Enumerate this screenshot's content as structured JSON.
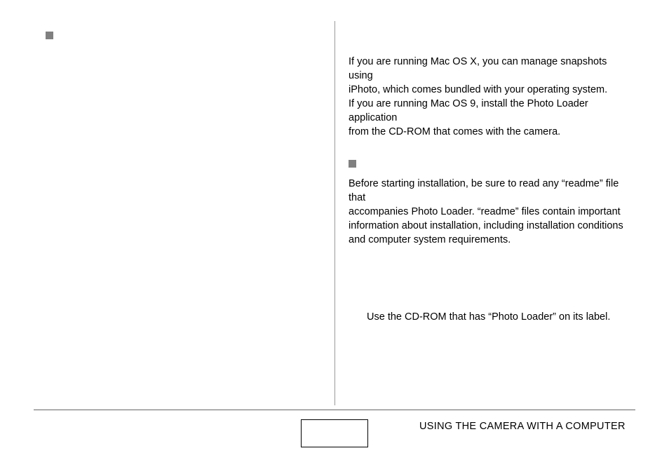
{
  "left": {},
  "right": {
    "para1_line1": "If you are running Mac OS X, you can manage snapshots using",
    "para1_line2": "iPhoto, which comes bundled with your operating system.",
    "para2_line1": "If you are running Mac OS 9, install the Photo Loader application",
    "para2_line2": "from the CD-ROM that comes with the camera.",
    "readme1": "Before starting installation, be sure to read any “readme” file that",
    "readme2": "accompanies Photo Loader. “readme” files contain important",
    "readme3": "information about installation, including installation conditions",
    "readme4": "and computer system requirements.",
    "cdrom": "Use the CD-ROM that has “Photo Loader” on its label."
  },
  "footer": {
    "section": "USING THE CAMERA WITH A COMPUTER"
  }
}
